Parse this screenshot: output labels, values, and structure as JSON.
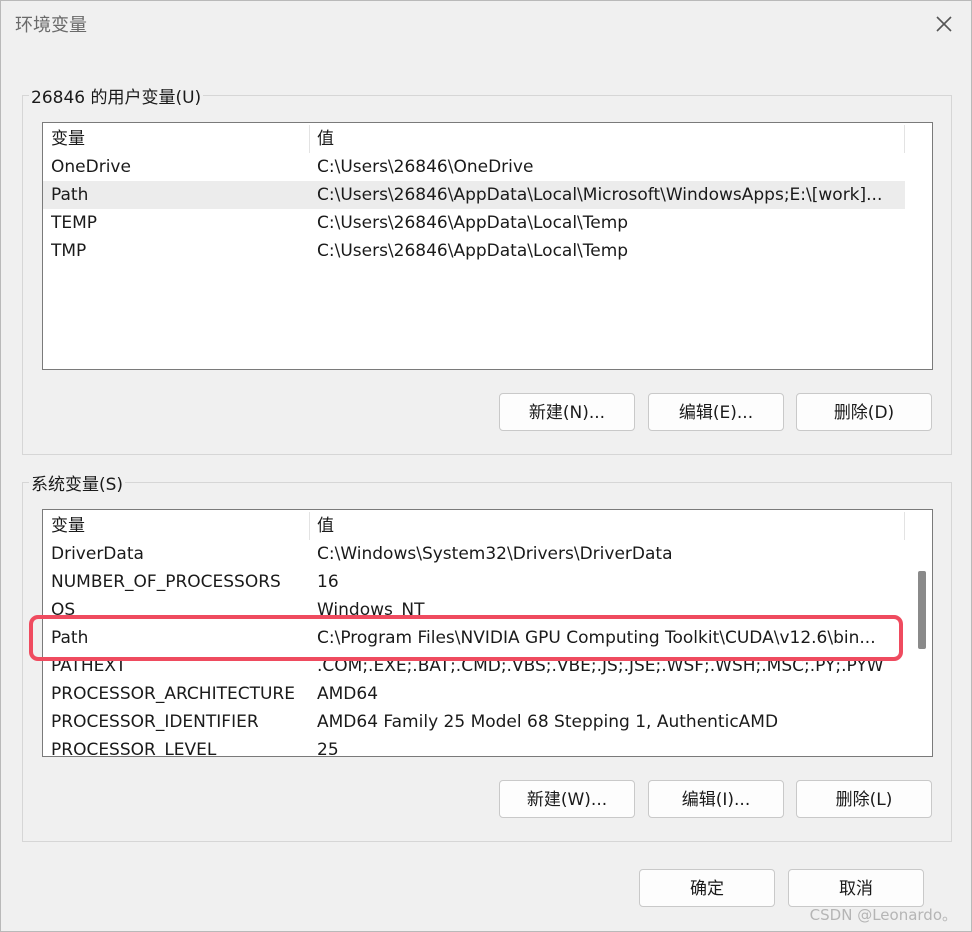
{
  "window": {
    "title": "环境变量"
  },
  "user_vars": {
    "label": "26846 的用户变量(U)",
    "columns": {
      "name": "变量",
      "value": "值"
    },
    "rows": [
      {
        "name": "OneDrive",
        "value": "C:\\Users\\26846\\OneDrive"
      },
      {
        "name": "Path",
        "value": "C:\\Users\\26846\\AppData\\Local\\Microsoft\\WindowsApps;E:\\[work]..."
      },
      {
        "name": "TEMP",
        "value": "C:\\Users\\26846\\AppData\\Local\\Temp"
      },
      {
        "name": "TMP",
        "value": "C:\\Users\\26846\\AppData\\Local\\Temp"
      }
    ],
    "buttons": {
      "new": "新建(N)...",
      "edit": "编辑(E)...",
      "delete": "删除(D)"
    }
  },
  "system_vars": {
    "label": "系统变量(S)",
    "columns": {
      "name": "变量",
      "value": "值"
    },
    "rows": [
      {
        "name": "DriverData",
        "value": "C:\\Windows\\System32\\Drivers\\DriverData"
      },
      {
        "name": "NUMBER_OF_PROCESSORS",
        "value": "16"
      },
      {
        "name": "OS",
        "value": "Windows_NT"
      },
      {
        "name": "Path",
        "value": "C:\\Program Files\\NVIDIA GPU Computing Toolkit\\CUDA\\v12.6\\bin..."
      },
      {
        "name": "PATHEXT",
        "value": ".COM;.EXE;.BAT;.CMD;.VBS;.VBE;.JS;.JSE;.WSF;.WSH;.MSC;.PY;.PYW"
      },
      {
        "name": "PROCESSOR_ARCHITECTURE",
        "value": "AMD64"
      },
      {
        "name": "PROCESSOR_IDENTIFIER",
        "value": "AMD64 Family 25 Model 68 Stepping 1, AuthenticAMD"
      },
      {
        "name": "PROCESSOR_LEVEL",
        "value": "25"
      }
    ],
    "buttons": {
      "new": "新建(W)...",
      "edit": "编辑(I)...",
      "delete": "删除(L)"
    }
  },
  "footer": {
    "ok": "确定",
    "cancel": "取消"
  },
  "watermark": "CSDN @Leonardo。",
  "colors": {
    "highlight": "#ef4b5f",
    "selected_row": "#ececec"
  },
  "icons": {
    "close": "close-icon"
  }
}
